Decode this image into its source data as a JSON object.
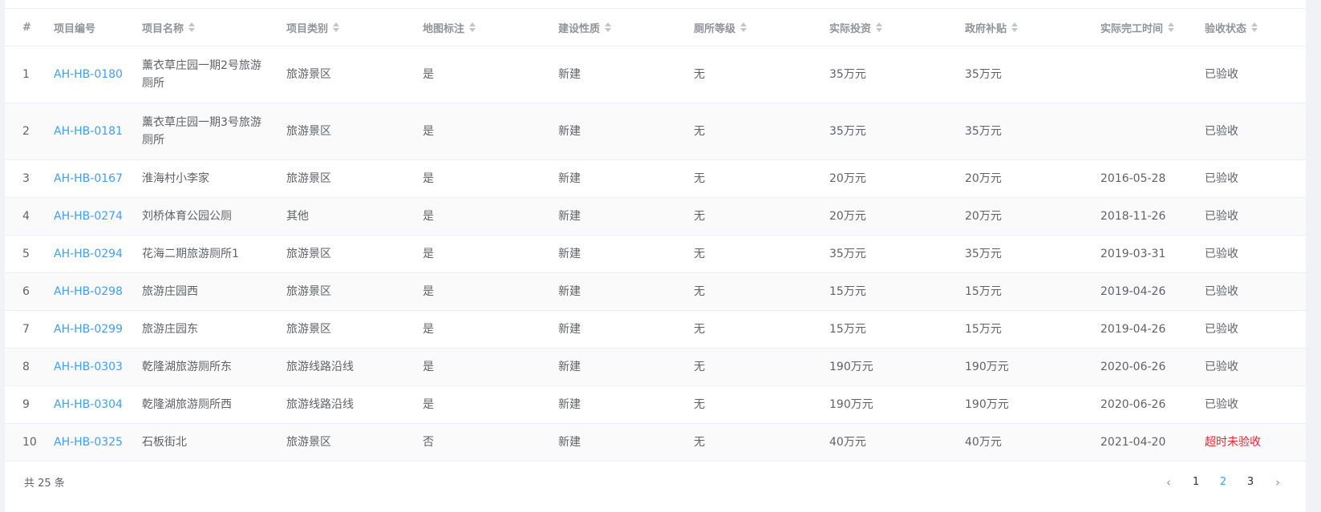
{
  "table": {
    "headers": {
      "idx": "#",
      "code": "项目编号",
      "name": "项目名称",
      "category": "项目类别",
      "map": "地图标注",
      "build": "建设性质",
      "grade": "厕所等级",
      "invest": "实际投资",
      "subsidy": "政府补贴",
      "date": "实际完工时间",
      "status": "验收状态"
    },
    "rows": [
      {
        "idx": "1",
        "code": "AH-HB-0180",
        "name": "薰衣草庄园一期2号旅游厕所",
        "category": "旅游景区",
        "map": "是",
        "build": "新建",
        "grade": "无",
        "invest": "35万元",
        "subsidy": "35万元",
        "date": "",
        "status": "已验收"
      },
      {
        "idx": "2",
        "code": "AH-HB-0181",
        "name": "薰衣草庄园一期3号旅游厕所",
        "category": "旅游景区",
        "map": "是",
        "build": "新建",
        "grade": "无",
        "invest": "35万元",
        "subsidy": "35万元",
        "date": "",
        "status": "已验收"
      },
      {
        "idx": "3",
        "code": "AH-HB-0167",
        "name": "淮海村小李家",
        "category": "旅游景区",
        "map": "是",
        "build": "新建",
        "grade": "无",
        "invest": "20万元",
        "subsidy": "20万元",
        "date": "2016-05-28",
        "status": "已验收"
      },
      {
        "idx": "4",
        "code": "AH-HB-0274",
        "name": "刘桥体育公园公厕",
        "category": "其他",
        "map": "是",
        "build": "新建",
        "grade": "无",
        "invest": "20万元",
        "subsidy": "20万元",
        "date": "2018-11-26",
        "status": "已验收"
      },
      {
        "idx": "5",
        "code": "AH-HB-0294",
        "name": "花海二期旅游厕所1",
        "category": "旅游景区",
        "map": "是",
        "build": "新建",
        "grade": "无",
        "invest": "35万元",
        "subsidy": "35万元",
        "date": "2019-03-31",
        "status": "已验收"
      },
      {
        "idx": "6",
        "code": "AH-HB-0298",
        "name": "旅游庄园西",
        "category": "旅游景区",
        "map": "是",
        "build": "新建",
        "grade": "无",
        "invest": "15万元",
        "subsidy": "15万元",
        "date": "2019-04-26",
        "status": "已验收"
      },
      {
        "idx": "7",
        "code": "AH-HB-0299",
        "name": "旅游庄园东",
        "category": "旅游景区",
        "map": "是",
        "build": "新建",
        "grade": "无",
        "invest": "15万元",
        "subsidy": "15万元",
        "date": "2019-04-26",
        "status": "已验收"
      },
      {
        "idx": "8",
        "code": "AH-HB-0303",
        "name": "乾隆湖旅游厕所东",
        "category": "旅游线路沿线",
        "map": "是",
        "build": "新建",
        "grade": "无",
        "invest": "190万元",
        "subsidy": "190万元",
        "date": "2020-06-26",
        "status": "已验收"
      },
      {
        "idx": "9",
        "code": "AH-HB-0304",
        "name": "乾隆湖旅游厕所西",
        "category": "旅游线路沿线",
        "map": "是",
        "build": "新建",
        "grade": "无",
        "invest": "190万元",
        "subsidy": "190万元",
        "date": "2020-06-26",
        "status": "已验收"
      },
      {
        "idx": "10",
        "code": "AH-HB-0325",
        "name": "石板街北",
        "category": "旅游景区",
        "map": "否",
        "build": "新建",
        "grade": "无",
        "invest": "40万元",
        "subsidy": "40万元",
        "date": "2021-04-20",
        "status": "超时未验收"
      }
    ]
  },
  "pagination": {
    "total_text": "共 25 条",
    "pages": [
      "1",
      "2",
      "3"
    ],
    "active_page": "2",
    "prev_icon": "chevron-left-icon",
    "next_icon": "chevron-right-icon"
  },
  "colors": {
    "link": "#409eff",
    "danger": "#f5222d",
    "header_text": "#909399",
    "stripe": "#fafafa"
  }
}
